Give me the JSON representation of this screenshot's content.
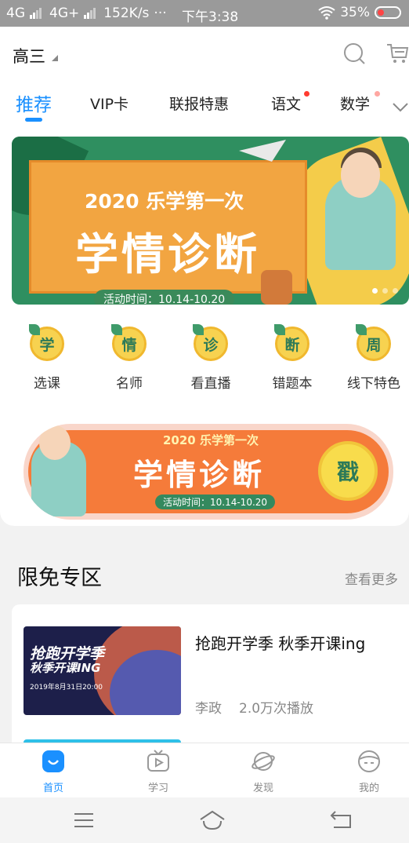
{
  "status_bar": {
    "network1": "4G",
    "network2": "4G+",
    "speed": "152K/s",
    "more": "···",
    "time": "下午3:38",
    "battery": "35%"
  },
  "header": {
    "grade": "高三",
    "icons": [
      "search-icon",
      "cart-icon"
    ]
  },
  "tabs": [
    {
      "label": "推荐",
      "active": true
    },
    {
      "label": "VIP卡"
    },
    {
      "label": "联报特惠"
    },
    {
      "label": "语文",
      "badge": true
    },
    {
      "label": "数学",
      "badge": true
    }
  ],
  "banner": {
    "year_line": "2020 乐学第一次",
    "title": "学情诊断",
    "date": "活动时间：10.14-10.20",
    "page_count": 3,
    "active_page": 1
  },
  "quick_links": [
    {
      "icon_char": "学",
      "label": "选课"
    },
    {
      "icon_char": "情",
      "label": "名师"
    },
    {
      "icon_char": "诊",
      "label": "看直播"
    },
    {
      "icon_char": "断",
      "label": "错题本"
    },
    {
      "icon_char": "周",
      "label": "线下特色"
    }
  ],
  "promo": {
    "year_line": "2020 乐学第一次",
    "title": "学情诊断",
    "date": "活动时间：10.14-10.20",
    "button": "戳"
  },
  "section": {
    "title": "限免专区",
    "more": "查看更多"
  },
  "list_items": [
    {
      "thumb_line1": "抢跑开学季",
      "thumb_line2": "秋季开课ING",
      "thumb_date": "2019年8月31日20:00",
      "title": "抢跑开学季 秋季开课ing",
      "author": "李政",
      "plays": "2.0万次播放"
    }
  ],
  "bottom_nav": [
    {
      "label": "首页",
      "icon": "home-icon",
      "active": true
    },
    {
      "label": "学习",
      "icon": "tv-icon"
    },
    {
      "label": "发现",
      "icon": "planet-icon"
    },
    {
      "label": "我的",
      "icon": "profile-icon"
    }
  ],
  "colors": {
    "accent": "#1a90ff",
    "badge": "#ff3b30",
    "banner_orange": "#f2a541",
    "banner_green": "#2f8f60"
  }
}
